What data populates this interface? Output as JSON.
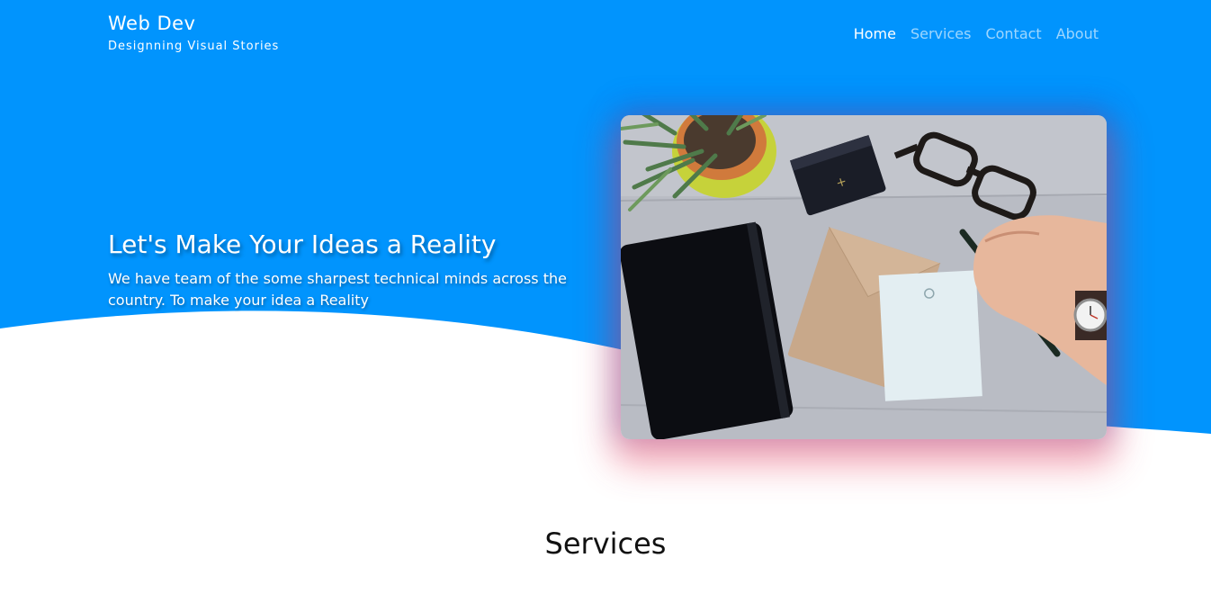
{
  "colors": {
    "hero_blue": "#0194fd",
    "wave_white": "#ffffff",
    "photo_glow": "#e93c5a"
  },
  "header": {
    "brand_title": "Web Dev",
    "brand_tagline": "Designning Visual Stories"
  },
  "nav": {
    "items": [
      {
        "label": "Home",
        "active": true
      },
      {
        "label": "Services",
        "active": false
      },
      {
        "label": "Contact",
        "active": false
      },
      {
        "label": "About",
        "active": false
      }
    ]
  },
  "hero": {
    "title": "Let's Make Your Ideas a Reality",
    "subtitle": "We have team of the some sharpest technical minds across the country. To make your idea a Reality",
    "image_subject": "desk-with-notebook-plant-glasses-envelope-hand-icon"
  },
  "services": {
    "heading": "Services"
  }
}
